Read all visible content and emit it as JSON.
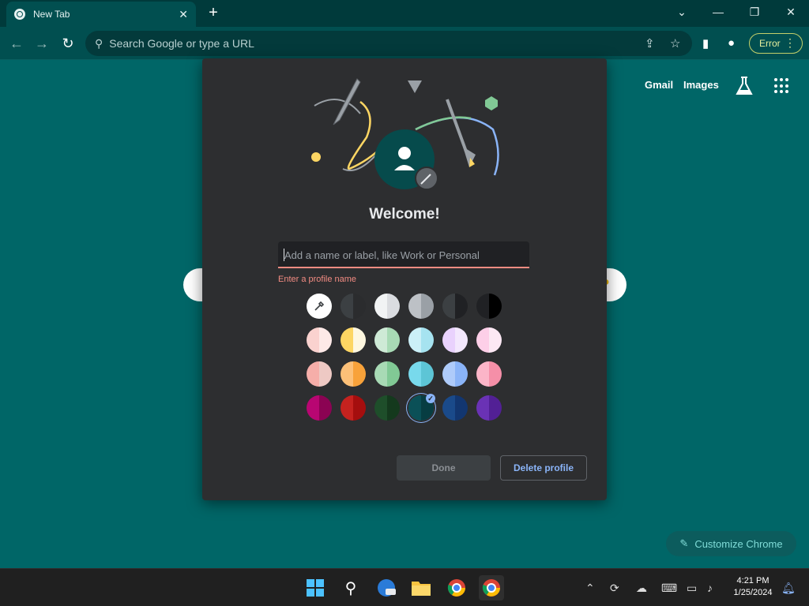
{
  "browser": {
    "tab_title": "New Tab",
    "omnibox_placeholder": "Search Google or type a URL",
    "profile_status": "Error",
    "icons": {
      "back": "←",
      "forward": "→",
      "reload": "↻",
      "search": "⚲",
      "share": "⇪",
      "star": "☆",
      "side_panel": "▮",
      "avatar": "●",
      "menu": "⋮"
    }
  },
  "ntp": {
    "gmail": "Gmail",
    "images": "Images",
    "customize_label": "Customize Chrome"
  },
  "dialog": {
    "title": "Welcome!",
    "name_placeholder": "Add a name or label, like Work or Personal",
    "error_text": "Enter a profile name",
    "done_label": "Done",
    "delete_label": "Delete profile",
    "selected_swatch": "row-4-col-4",
    "swatch_rows": [
      [
        [
          "#3c4043",
          "#2b2c2e"
        ],
        [
          "#f1f3f4",
          "#dadce0"
        ],
        [
          "#bdc1c6",
          "#9aa0a6"
        ],
        [
          "#3c4043",
          "#202124"
        ],
        [
          "#202124",
          "#000000"
        ]
      ],
      [
        [
          "#fad2cf",
          "#fde9e7"
        ],
        [
          "#fdd663",
          "#fef7e0"
        ],
        [
          "#ceead6",
          "#a8dab5"
        ],
        [
          "#cbf0f8",
          "#a6e3f0"
        ],
        [
          "#e9d2fd",
          "#f3e8fd"
        ],
        [
          "#fdcfe8",
          "#fce8f4"
        ]
      ],
      [
        [
          "#f6aea9",
          "#eec9c4"
        ],
        [
          "#fcc078",
          "#f8a23a"
        ],
        [
          "#a8dab5",
          "#81c995"
        ],
        [
          "#78d9ec",
          "#5dc5d6"
        ],
        [
          "#aecbfa",
          "#8ab4f8"
        ],
        [
          "#fbb5c8",
          "#f58fa8"
        ]
      ],
      [
        [
          "#b80672",
          "#8b0353"
        ],
        [
          "#c5221f",
          "#a50e0e"
        ],
        [
          "#1e4e2a",
          "#14391d"
        ],
        [
          "#0b5057",
          "#073d42"
        ],
        [
          "#1a4a8a",
          "#123670"
        ],
        [
          "#6a32b5",
          "#522095"
        ]
      ]
    ]
  },
  "taskbar": {
    "time": "4:21 PM",
    "date": "1/25/2024",
    "tray_icons": [
      "chevron-up-icon",
      "sync-icon",
      "onedrive-icon",
      "keyboard-icon",
      "display-icon",
      "volume-icon",
      "notification-icon"
    ]
  },
  "colors": {
    "page_bg": "#006667",
    "dialog_bg": "#2d2e30",
    "accent": "#8ab4f8",
    "error": "#f28b82"
  }
}
